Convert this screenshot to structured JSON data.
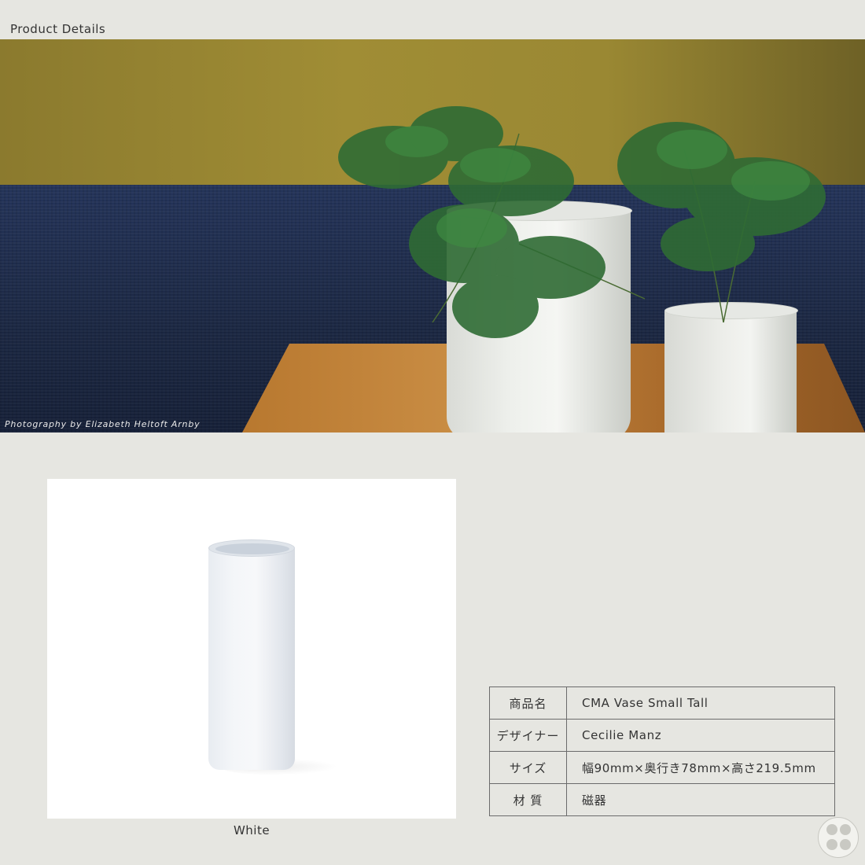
{
  "header": {
    "title": "Product Details"
  },
  "hero": {
    "photo_credit": "Photography by Elizabeth Heltoft Arnby"
  },
  "product": {
    "variant_label": "White"
  },
  "specs": [
    {
      "label": "商品名",
      "value": "CMA Vase Small Tall"
    },
    {
      "label": "デザイナー",
      "value": "Cecilie Manz"
    },
    {
      "label": "サイズ",
      "value": "幅90mm×奥行き78mm×高さ219.5mm"
    },
    {
      "label": "材 質",
      "value": "磁器"
    }
  ],
  "brand": {
    "logo_icon": "brand-seal-icon"
  }
}
